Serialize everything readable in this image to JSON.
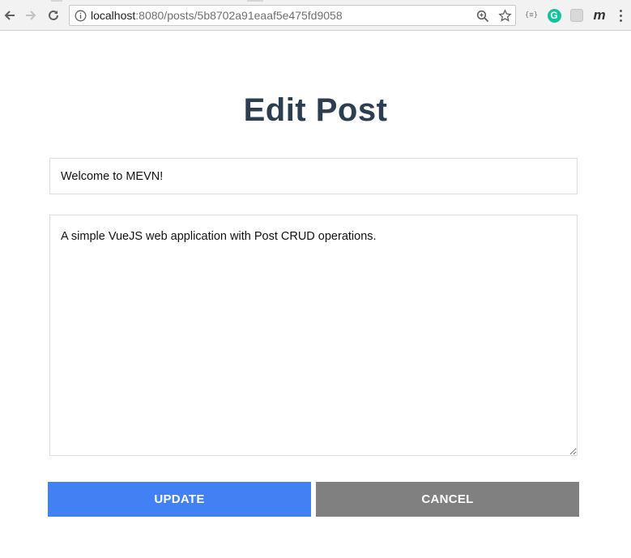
{
  "browser": {
    "url_host": "localhost",
    "url_path": ":8080/posts/5b8702a91eaaf5e475fd9058",
    "extensions": {
      "json_viewer": "{≡}",
      "grammarly": "G",
      "m_ext": "m"
    }
  },
  "page": {
    "title": "Edit Post",
    "post_title_value": "Welcome to MEVN!",
    "post_description_value": "A simple VueJS web application with Post CRUD operations."
  },
  "actions": {
    "update_label": "UPDATE",
    "cancel_label": "CANCEL"
  },
  "colors": {
    "title_text": "#2c3e50",
    "update_button": "#4281f4",
    "cancel_button": "#808080",
    "grammarly_green": "#15c39a"
  }
}
